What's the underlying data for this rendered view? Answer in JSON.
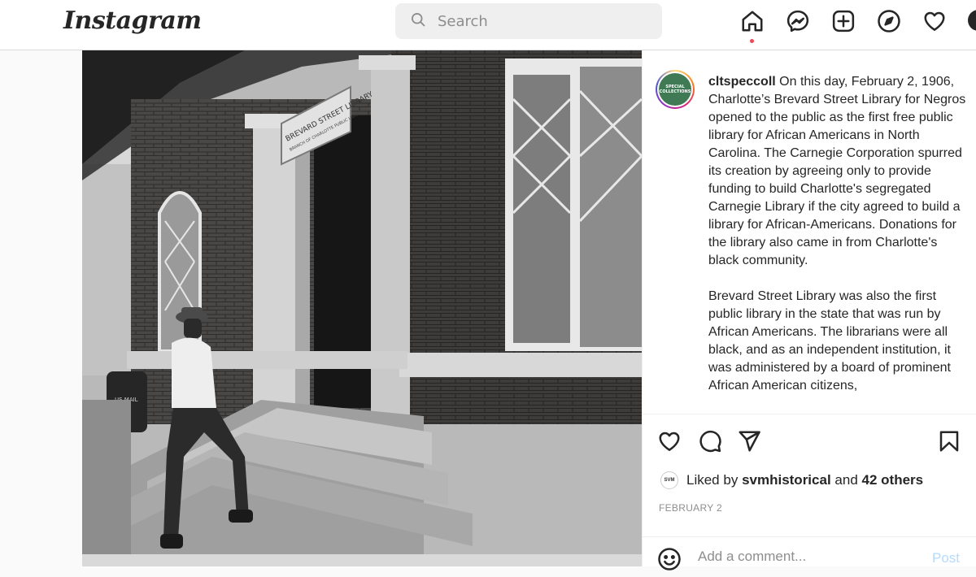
{
  "header": {
    "logo_text": "Instagram",
    "search": {
      "placeholder": "Search",
      "icon": "search-icon"
    },
    "nav_icons": [
      "home-icon",
      "messenger-icon",
      "new-post-icon",
      "explore-icon",
      "activity-heart-icon",
      "profile-avatar"
    ]
  },
  "post": {
    "photo": {
      "sign_line1": "BREVARD STREET LIBRARY",
      "sign_line2": "BRANCH OF CHARLOTTE PUBLIC LIBRARY",
      "mailbox_label": "US MAIL"
    },
    "owner": {
      "username": "cltspeccoll",
      "avatar_text": "SPECIAL COLLECTIONS"
    },
    "caption": {
      "paragraph1": "On this day, February 2, 1906, Charlotte’s Brevard Street Library for Negros opened to the public as the first free public library for African Americans in North Carolina. The Carnegie Corporation spurred its creation by agreeing only to provide funding to build Charlotte's segregated Carnegie Library if the city agreed to build a library for African-Americans. Donations for the library also came in from Charlotte's black community.",
      "paragraph2": "Brevard Street Library was also the first public library in the state that was run by African Americans. The librarians were all black, and as an independent institution, it was administered by a board of prominent African American citizens,"
    },
    "actions": [
      "like-heart-icon",
      "comment-icon",
      "share-icon",
      "save-bookmark-icon"
    ],
    "likes": {
      "prefix": "Liked by",
      "liker": "svmhistorical",
      "liker_avatar_text": "SVM",
      "joiner": "and",
      "others": "42 others"
    },
    "date": "FEBRUARY 2",
    "comment": {
      "placeholder": "Add a comment...",
      "post_label": "Post"
    }
  },
  "colors": {
    "nav_active_dot": "#ed4956",
    "post_button_disabled": "#b3dbff",
    "secondary_text": "#8e8e8e",
    "border": "#dbdbdb"
  }
}
